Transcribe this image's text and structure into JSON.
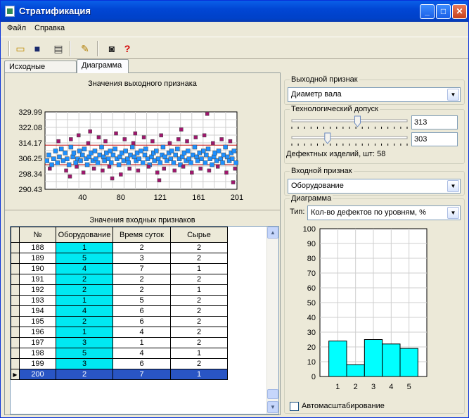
{
  "window": {
    "title": "Стратификация"
  },
  "menu": [
    "Файл",
    "Справка"
  ],
  "toolbar": {
    "icons": [
      "open-folder-icon",
      "save-disk-icon",
      "print-icon",
      "export-icon",
      "camera-icon",
      "help-icon"
    ]
  },
  "tabs": [
    {
      "label": "Исходные данные",
      "active": false
    },
    {
      "label": "Диаграмма",
      "active": true
    }
  ],
  "output_chart": {
    "title": "Значения выходного признака",
    "y_ticks": [
      "329.99",
      "322.08",
      "314.17",
      "306.25",
      "298.34",
      "290.43"
    ],
    "x_ticks": [
      "40",
      "80",
      "121",
      "161",
      "201"
    ]
  },
  "input_table": {
    "title": "Значения входных признаков",
    "columns": [
      "№",
      "Оборудование",
      "Время суток",
      "Сырье"
    ],
    "rows": [
      [
        "188",
        "1",
        "2",
        "2"
      ],
      [
        "189",
        "5",
        "3",
        "2"
      ],
      [
        "190",
        "4",
        "7",
        "1"
      ],
      [
        "191",
        "2",
        "2",
        "2"
      ],
      [
        "192",
        "2",
        "2",
        "1"
      ],
      [
        "193",
        "1",
        "5",
        "2"
      ],
      [
        "194",
        "4",
        "6",
        "2"
      ],
      [
        "195",
        "2",
        "6",
        "2"
      ],
      [
        "196",
        "1",
        "4",
        "2"
      ],
      [
        "197",
        "3",
        "1",
        "2"
      ],
      [
        "198",
        "5",
        "4",
        "1"
      ],
      [
        "199",
        "3",
        "6",
        "2"
      ],
      [
        "200",
        "2",
        "7",
        "1"
      ]
    ],
    "selected_row": "200"
  },
  "output_feature": {
    "label": "Выходной признак",
    "value": "Диаметр вала"
  },
  "tolerance": {
    "label": "Технологический допуск",
    "upper": "313",
    "lower": "303",
    "upper_slider_fraction": 0.57,
    "lower_slider_fraction": 0.31,
    "defects_text": "Дефектных изделий, шт: 58"
  },
  "input_feature": {
    "label": "Входной признак",
    "value": "Оборудование"
  },
  "diagram": {
    "label": "Диаграмма",
    "type_label": "Тип:",
    "type_value": "Кол-во дефектов по уровням, %",
    "autoscale_label": "Автомасштабирование",
    "autoscale_checked": false
  },
  "colors": {
    "highlight": "#00e9f2",
    "selection": "#2955c4",
    "bar_fill": "#00ffff",
    "point_in": "#1e90ff",
    "point_out": "#a0166e",
    "limit_line": "#c00000"
  },
  "chart_data": [
    {
      "type": "scatter",
      "title": "Значения выходного признака",
      "xlim": [
        1,
        201
      ],
      "ylim": [
        290.43,
        329.99
      ],
      "x_ticks": [
        40,
        80,
        121,
        161,
        201
      ],
      "y_ticks": [
        290.43,
        298.34,
        306.25,
        314.17,
        322.08,
        329.99
      ],
      "upper_limit": 313,
      "lower_limit": 303,
      "x": [
        3,
        5,
        8,
        10,
        12,
        14,
        16,
        18,
        20,
        22,
        24,
        26,
        28,
        30,
        31,
        33,
        35,
        37,
        38,
        40,
        42,
        44,
        45,
        47,
        49,
        51,
        53,
        54,
        56,
        58,
        60,
        62,
        63,
        65,
        67,
        69,
        70,
        72,
        74,
        76,
        78,
        79,
        81,
        83,
        85,
        87,
        88,
        90,
        92,
        94,
        96,
        97,
        99,
        101,
        103,
        105,
        106,
        108,
        110,
        112,
        114,
        115,
        117,
        119,
        121,
        123,
        124,
        126,
        128,
        130,
        132,
        133,
        135,
        137,
        139,
        141,
        142,
        144,
        146,
        148,
        150,
        151,
        153,
        155,
        157,
        159,
        160,
        162,
        164,
        166,
        168,
        169,
        171,
        173,
        175,
        177,
        178,
        180,
        182,
        184,
        186,
        187,
        189,
        191,
        193,
        195,
        196,
        198,
        200,
        6,
        15,
        23,
        28,
        34,
        36,
        41,
        46,
        52,
        57,
        61,
        64,
        68,
        75,
        80,
        84,
        89,
        93,
        98,
        104,
        109,
        113,
        118,
        122,
        125,
        131,
        136,
        140,
        145,
        149,
        154,
        158,
        163,
        167,
        172,
        176,
        181,
        185,
        190,
        194,
        199,
        27,
        48,
        71,
        95,
        120,
        143,
        170,
        197
      ],
      "y": [
        305,
        308,
        303,
        306,
        310,
        304,
        307,
        311,
        305,
        309,
        306,
        303,
        312,
        307,
        309,
        304,
        306,
        310,
        305,
        308,
        311,
        306,
        303,
        307,
        309,
        305,
        310,
        306,
        304,
        308,
        312,
        307,
        305,
        309,
        306,
        310,
        304,
        308,
        311,
        306,
        303,
        307,
        309,
        305,
        310,
        306,
        304,
        308,
        312,
        307,
        305,
        309,
        306,
        310,
        304,
        308,
        311,
        306,
        303,
        307,
        309,
        305,
        310,
        306,
        304,
        308,
        312,
        307,
        305,
        309,
        306,
        310,
        304,
        308,
        311,
        306,
        303,
        307,
        309,
        305,
        310,
        306,
        304,
        308,
        312,
        307,
        305,
        309,
        306,
        310,
        304,
        308,
        311,
        306,
        303,
        307,
        309,
        305,
        310,
        306,
        304,
        308,
        312,
        307,
        305,
        309,
        306,
        310,
        304,
        301,
        315,
        300,
        316,
        302,
        318,
        299,
        314,
        301,
        317,
        300,
        315,
        302,
        319,
        298,
        316,
        301,
        314,
        300,
        317,
        302,
        315,
        299,
        318,
        301,
        314,
        300,
        316,
        302,
        315,
        299,
        317,
        301,
        318,
        300,
        314,
        302,
        316,
        299,
        315,
        301,
        297,
        320,
        296,
        319,
        295,
        321,
        329,
        294
      ]
    },
    {
      "type": "bar",
      "title": "",
      "categories": [
        "1",
        "2",
        "3",
        "4",
        "5"
      ],
      "values": [
        24,
        8,
        25,
        22,
        19
      ],
      "ylim": [
        0,
        100
      ],
      "y_ticks": [
        0,
        10,
        20,
        30,
        40,
        50,
        60,
        70,
        80,
        90,
        100
      ]
    }
  ]
}
